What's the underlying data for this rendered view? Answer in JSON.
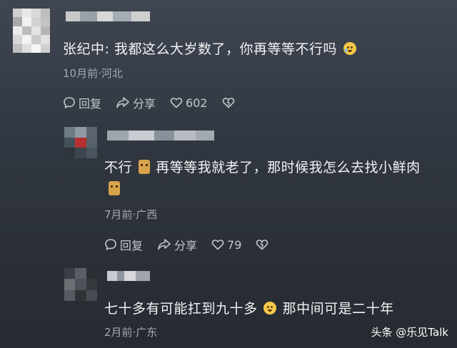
{
  "comments": [
    {
      "text_prefix": "张纪中: 我都这么大岁数了，你再等等不行吗",
      "emoji": "loudly-crying-face-emoji",
      "meta": "10月前·河北",
      "actions": {
        "reply": "回复",
        "share": "分享",
        "likes": "602"
      }
    },
    {
      "text_a": "不行",
      "text_b": "再等等我就老了，那时候我怎么去找小鲜肉",
      "emoji": "doge-emoji",
      "meta": "7月前·广西",
      "actions": {
        "reply": "回复",
        "share": "分享",
        "likes": "79"
      }
    },
    {
      "text_a": "七十多有可能扛到九十多",
      "text_b": "那中间可是二十年",
      "emoji": "grinning-sweat-face-emoji",
      "meta": "2月前·广东"
    }
  ],
  "watermark": "头条 @乐见Talk",
  "colors": {
    "text": "#f2f3f5",
    "meta": "#a4a9b1",
    "action": "#c3c7cd"
  }
}
